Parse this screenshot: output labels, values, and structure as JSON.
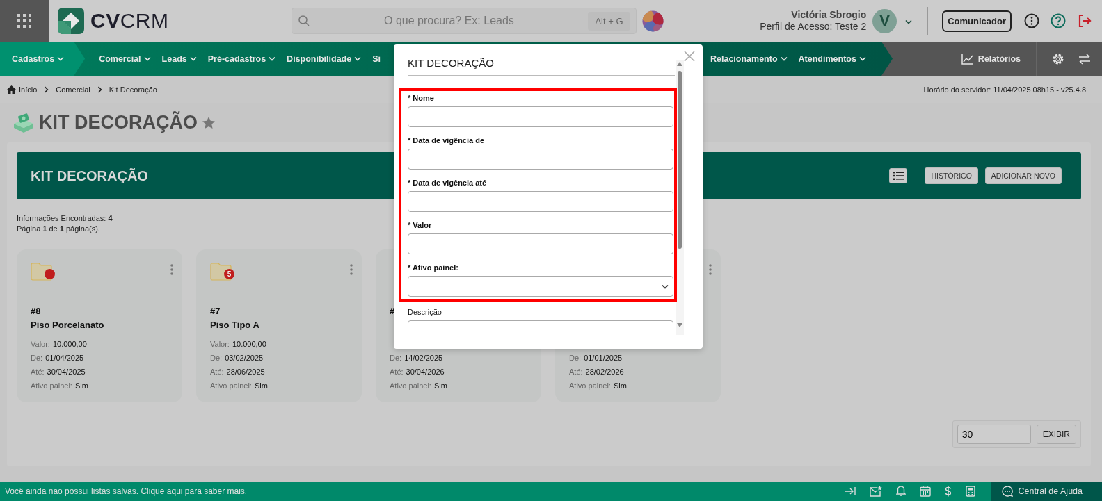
{
  "header": {
    "logo": {
      "bold": "CV",
      "regular": "CRM"
    },
    "search": {
      "placeholder": "O que procura? Ex: Leads",
      "shortcut": "Alt + G"
    },
    "user": {
      "name": "Victória Sbrogio",
      "profile": "Perfil de Acesso: Teste 2",
      "initial": "V"
    },
    "communicator": "Comunicador"
  },
  "nav": {
    "items": [
      {
        "label": "Cadastros",
        "selected": true,
        "dropdown": true
      },
      {
        "label": "Comercial",
        "selected": false,
        "dropdown": true
      },
      {
        "label": "Leads",
        "selected": false,
        "dropdown": true
      },
      {
        "label": "Pré-cadastros",
        "selected": false,
        "dropdown": true
      },
      {
        "label": "Disponibilidade",
        "selected": false,
        "dropdown": true
      },
      {
        "label": "Si",
        "selected": false,
        "dropdown": false
      }
    ],
    "right_items": [
      {
        "label": "Relacionamento",
        "dropdown": true
      },
      {
        "label": "Atendimentos",
        "dropdown": true
      }
    ],
    "reports": "Relatórios"
  },
  "breadcrumb": {
    "items": [
      "Início",
      "Comercial",
      "Kit Decoração"
    ],
    "server_info": "Horário do servidor: 11/04/2025 08h15 - v25.4.8"
  },
  "page_title": "KIT DECORAÇÃO",
  "favorite": false,
  "banner": {
    "title": "KIT DECORAÇÃO",
    "buttons": [
      "HISTÓRICO",
      "ADICIONAR NOVO"
    ]
  },
  "summary": [
    "Informações Encontradas: **4**",
    "Página **1** de **1** página(s)."
  ],
  "cards": [
    {
      "folder": {
        "alert": true
      },
      "menu": true,
      "number": "#8",
      "name": "Piso Porcelanato",
      "rows": [
        {
          "label": "Valor:",
          "value": "10.000,00"
        },
        {
          "label": "De:",
          "value": "01/04/2025"
        },
        {
          "label": "Até:",
          "value": "30/04/2025"
        },
        {
          "label": "Ativo painel:",
          "value": "Sim"
        }
      ]
    },
    {
      "folder": {
        "alert": true,
        "count": "5"
      },
      "menu": true,
      "number": "#7",
      "name": "Piso Tipo A",
      "rows": [
        {
          "label": "Valor:",
          "value": "10.000,00"
        },
        {
          "label": "De:",
          "value": "03/02/2025"
        },
        {
          "label": "Até:",
          "value": "28/06/2025"
        },
        {
          "label": "Ativo painel:",
          "value": "Sim"
        }
      ]
    },
    {
      "menu": false,
      "number": "#",
      "rows": [
        {
          "label": "De:",
          "value": "14/02/2025"
        },
        {
          "label": "Até:",
          "value": "30/04/2026"
        },
        {
          "label": "Ativo painel:",
          "value": "Sim"
        }
      ]
    },
    {
      "menu": true,
      "rows": [
        {
          "label": "De:",
          "value": "01/01/2025"
        },
        {
          "label": "Até:",
          "value": "28/02/2026"
        },
        {
          "label": "Ativo painel:",
          "value": "Sim"
        }
      ]
    }
  ],
  "pagination": {
    "per_page": "30",
    "button": "EXIBIR"
  },
  "modal": {
    "title": "KIT DECORAÇÃO",
    "highlighted_fields": [
      {
        "label": "* Nome",
        "kind": "text"
      },
      {
        "label": "* Data de vigência de",
        "kind": "text"
      },
      {
        "label": "* Data de vigência até",
        "kind": "text"
      },
      {
        "label": "* Valor",
        "kind": "text"
      },
      {
        "label": "* Ativo painel:",
        "kind": "select"
      }
    ],
    "fields": [
      {
        "label": "Descrição",
        "kind": "textarea"
      }
    ]
  },
  "status_bar": {
    "message": "Você ainda não possui listas salvas. Clique aqui para saber mais.",
    "help": "Central de Ajuda"
  }
}
